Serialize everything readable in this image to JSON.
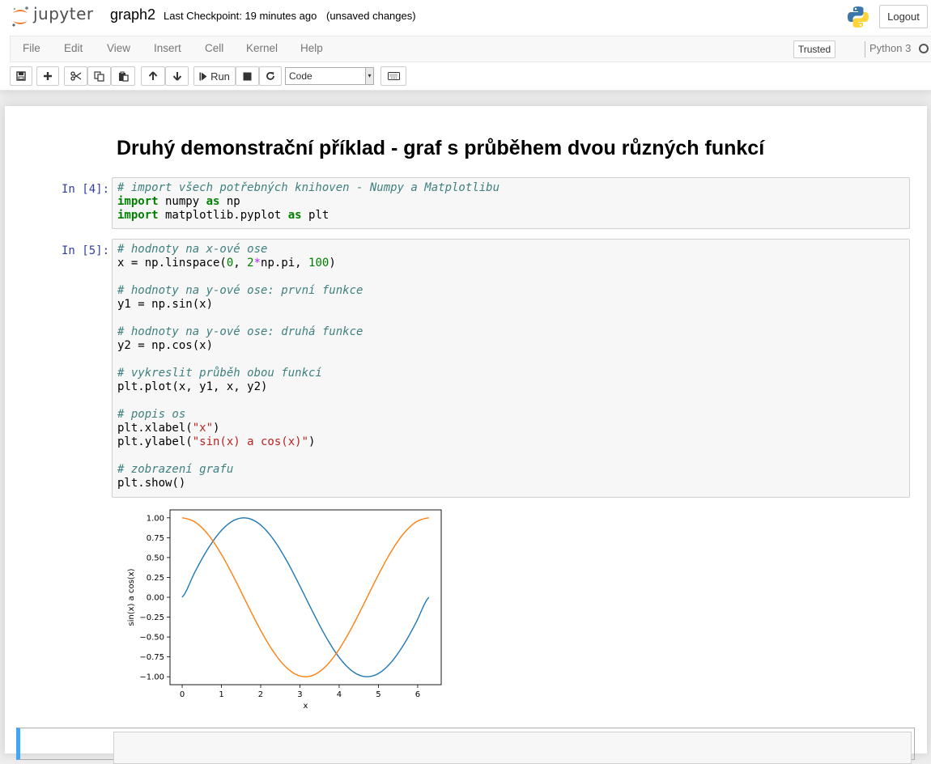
{
  "header": {
    "logo_text": "jupyter",
    "notebook_name": "graph2",
    "checkpoint": "Last Checkpoint: 19 minutes ago",
    "status": "(unsaved changes)",
    "logout_label": "Logout"
  },
  "menubar": {
    "items": [
      "File",
      "Edit",
      "View",
      "Insert",
      "Cell",
      "Kernel",
      "Help"
    ],
    "trusted_label": "Trusted",
    "kernel_name": "Python 3"
  },
  "toolbar": {
    "buttons": [
      "save-icon",
      "plus-icon",
      "cut-icon",
      "copy-icon",
      "paste-icon",
      "arrow-up-icon",
      "arrow-down-icon",
      "run-icon",
      "stop-icon",
      "restart-icon",
      "keyboard-icon"
    ],
    "run_label": "Run",
    "cell_type": "Code"
  },
  "notebook": {
    "heading": "Druhý demonstrační příklad - graf s průběhem dvou různých funkcí",
    "cells": [
      {
        "prompt": "In [4]:",
        "lines": [
          "# import všech potřebných knihoven - Numpy a Matplotlibu",
          "import numpy as np",
          "import matplotlib.pyplot as plt"
        ]
      },
      {
        "prompt": "In [5]:",
        "lines": [
          "# hodnoty na x-ové ose",
          "x = np.linspace(0, 2*np.pi, 100)",
          "",
          "# hodnoty na y-ové ose: první funkce",
          "y1 = np.sin(x)",
          "",
          "# hodnoty na y-ové ose: druhá funkce",
          "y2 = np.cos(x)",
          "",
          "# vykreslit průběh obou funkcí",
          "plt.plot(x, y1, x, y2)",
          "",
          "# popis os",
          "plt.xlabel(\"x\")",
          "plt.ylabel(\"sin(x) a cos(x)\")",
          "",
          "# zobrazení grafu",
          "plt.show()"
        ]
      }
    ]
  },
  "chart_data": {
    "type": "line",
    "title": "",
    "xlabel": "x",
    "ylabel": "sin(x) a cos(x)",
    "xlim": [
      -0.31,
      6.6
    ],
    "ylim": [
      -1.1,
      1.1
    ],
    "xticks": [
      0,
      1,
      2,
      3,
      4,
      5,
      6
    ],
    "yticks": [
      -1.0,
      -0.75,
      -0.5,
      -0.25,
      0.0,
      0.25,
      0.5,
      0.75,
      1.0
    ],
    "ytick_labels": [
      "−1.00",
      "−0.75",
      "−0.50",
      "−0.25",
      "0.00",
      "0.25",
      "0.50",
      "0.75",
      "1.00"
    ],
    "grid": false,
    "x": [
      0,
      0.3307,
      0.6614,
      0.9921,
      1.3228,
      1.6535,
      1.9842,
      2.3149,
      2.6456,
      2.9762,
      3.3069,
      3.6376,
      3.9683,
      4.299,
      4.6297,
      4.9604,
      5.2911,
      5.6218,
      5.9525,
      6.2832
    ],
    "series": [
      {
        "color": "#1f77b4",
        "values": [
          0.0,
          0.3247,
          0.6142,
          0.8372,
          0.9694,
          0.9966,
          0.9158,
          0.7357,
          0.4759,
          0.1646,
          -0.1646,
          -0.4759,
          -0.7357,
          -0.9158,
          -0.9966,
          -0.9694,
          -0.8372,
          -0.6142,
          -0.3247,
          0.0
        ]
      },
      {
        "color": "#ff7f0e",
        "values": [
          1.0,
          0.9458,
          0.7891,
          0.5469,
          0.2455,
          -0.0826,
          -0.4017,
          -0.6773,
          -0.8795,
          -0.9864,
          -0.9864,
          -0.8795,
          -0.6773,
          -0.4017,
          -0.0826,
          0.2455,
          0.5469,
          0.7891,
          0.9458,
          1.0
        ]
      }
    ]
  }
}
